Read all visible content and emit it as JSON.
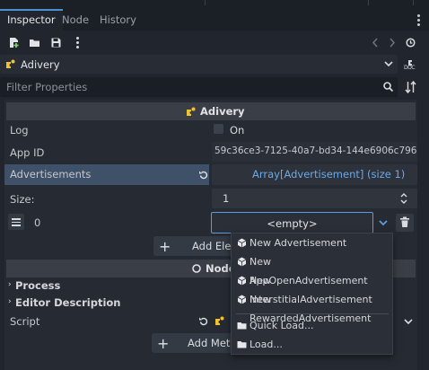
{
  "tabs": [
    {
      "label": "Inspector"
    },
    {
      "label": "Node"
    },
    {
      "label": "History"
    }
  ],
  "object": {
    "name": "Adivery"
  },
  "filter": {
    "placeholder": "Filter Properties"
  },
  "section": {
    "title": "Adivery"
  },
  "properties": {
    "log": {
      "label": "Log",
      "value": "On"
    },
    "app_id": {
      "label": "App ID",
      "value": "59c36ce3-7125-40a7-bd34-144e6906c796"
    },
    "advertisements": {
      "label": "Advertisements",
      "value": "Array[Advertisement] (size 1)"
    },
    "size": {
      "label": "Size:",
      "value": "1"
    },
    "element0": {
      "index": "0",
      "value": "<empty>"
    }
  },
  "add_element": {
    "label": "Add Elem"
  },
  "node_section": {
    "title": "Node"
  },
  "groups": [
    {
      "label": "Process"
    },
    {
      "label": "Editor Description"
    }
  ],
  "script": {
    "label": "Script"
  },
  "add_metadata": {
    "label": "Add Metad"
  },
  "menu": {
    "items": [
      {
        "label": "New Advertisement"
      },
      {
        "label": "New AppOpenAdvertisement"
      },
      {
        "label": "New InterstitialAdvertisement"
      },
      {
        "label": "New RewardedAdvertisement"
      },
      {
        "label": "Quick Load..."
      },
      {
        "label": "Load..."
      }
    ]
  },
  "colors": {
    "accent": "#4a8fd8",
    "link": "#6aa9e9",
    "icon_yellow": "#f1c232"
  }
}
